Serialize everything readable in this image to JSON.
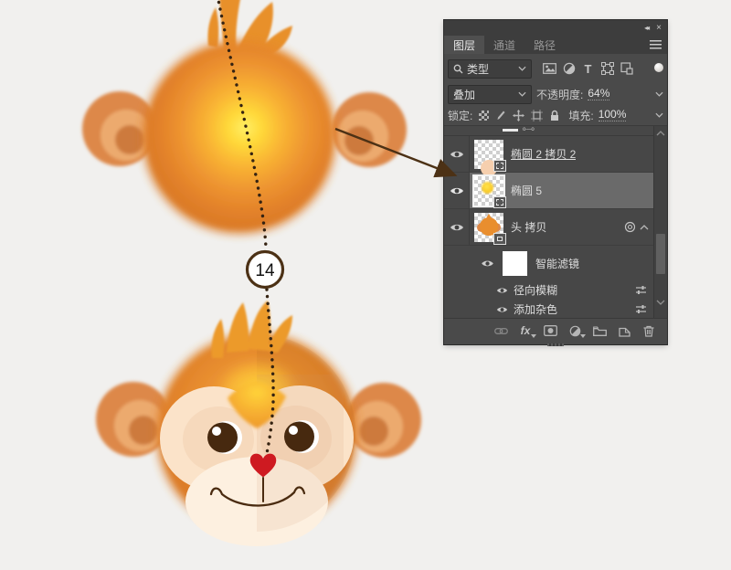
{
  "background_color": "#f1f0ee",
  "annotation": {
    "step_number": "14",
    "arrow_color": "#4c3115",
    "dot_color": "#352312"
  },
  "panel": {
    "header": {
      "collapse_icon": "◂◂",
      "close_icon": "×"
    },
    "tabs": [
      {
        "label": "图层",
        "active": true
      },
      {
        "label": "通道",
        "active": false
      },
      {
        "label": "路径",
        "active": false
      }
    ],
    "filter_row": {
      "search_type_label": "类型",
      "type_glyph": "T",
      "filter_icons": [
        "pixel-layer-filter",
        "adjustment-layer-filter",
        "type-layer-filter",
        "shape-layer-filter",
        "smart-object-filter",
        "filter-toggle"
      ]
    },
    "blend_row": {
      "blend_mode": "叠加",
      "opacity_label": "不透明度:",
      "opacity_value": "64%"
    },
    "lock_row": {
      "lock_label": "锁定:",
      "fill_label": "填充:",
      "fill_value": "100%"
    },
    "layers": [
      {
        "name": "椭圆 2 拷贝 2",
        "visible": true,
        "selected": false,
        "kind": "shape"
      },
      {
        "name": "椭圆 5",
        "visible": true,
        "selected": true,
        "kind": "shape"
      },
      {
        "name": "头 拷贝",
        "visible": true,
        "selected": false,
        "kind": "smart-object"
      }
    ],
    "smart_filters": {
      "title": "智能滤镜",
      "items": [
        {
          "name": "径向模糊"
        },
        {
          "name": "添加杂色"
        }
      ]
    },
    "fx_label": "fx",
    "footer_icons": [
      "link-layers",
      "layer-effects",
      "add-layer-mask",
      "new-adjustment-layer",
      "new-group",
      "new-layer",
      "delete-layer"
    ],
    "colors": {
      "panel_bg": "#4a4a4a",
      "selected_row": "#6a6a6a",
      "control_bg": "#3e3e3e"
    }
  },
  "artwork": {
    "description_colors": {
      "fur_orange": "#e5832a",
      "fur_yellow_glow": "#ffe14a",
      "face_cream": "#fbe3c9",
      "muzzle_cream": "#fdf0e0",
      "eye_brown": "#47290f",
      "nose_red": "#ce1a21"
    }
  }
}
